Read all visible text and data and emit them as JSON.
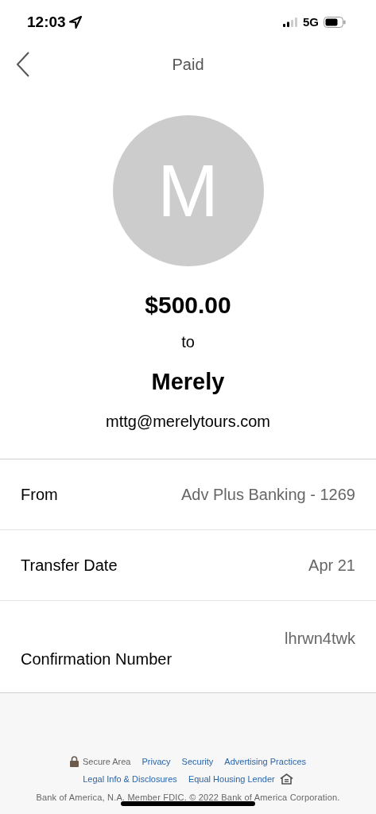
{
  "status_bar": {
    "time": "12:03",
    "network": "5G"
  },
  "nav": {
    "title": "Paid"
  },
  "payment": {
    "avatar_letter": "M",
    "amount": "$500.00",
    "connector": "to",
    "recipient": "Merely",
    "email": "mttg@merelytours.com"
  },
  "details": [
    {
      "label": "From",
      "value": "Adv Plus Banking - 1269"
    },
    {
      "label": "Transfer Date",
      "value": "Apr 21"
    },
    {
      "label": "Confirmation Number",
      "value": "lhrwn4twk"
    }
  ],
  "footer": {
    "secure": "Secure Area",
    "links": [
      {
        "label": "Privacy"
      },
      {
        "label": "Security"
      },
      {
        "label": "Advertising Practices"
      }
    ],
    "links_2": [
      {
        "label": "Legal Info & Disclosures"
      },
      {
        "label": "Equal Housing Lender"
      }
    ],
    "legal": "Bank of America, N.A. Member FDIC. © 2022 Bank of America Corporation."
  }
}
